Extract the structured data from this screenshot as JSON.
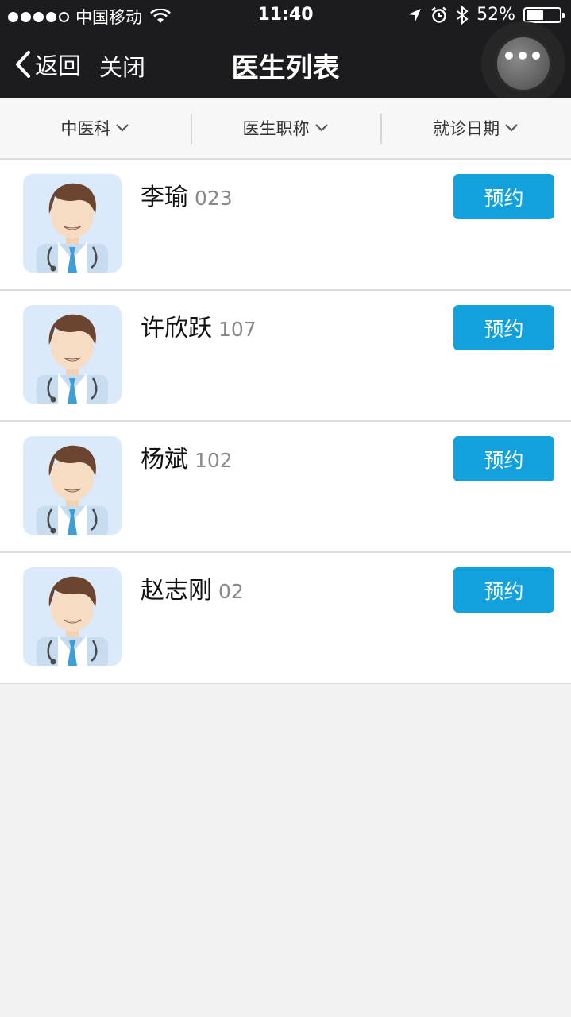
{
  "status_bar": {
    "carrier": "中国移动",
    "time": "11:40",
    "battery_percent": "52%",
    "battery_level": 0.52,
    "icons": [
      "signal-dots-icon",
      "wifi-icon",
      "location-arrow-icon",
      "alarm-clock-icon",
      "bluetooth-icon",
      "battery-icon"
    ]
  },
  "nav": {
    "back_label": "返回",
    "close_label": "关闭",
    "title": "医生列表"
  },
  "filters": [
    {
      "label": "中医科"
    },
    {
      "label": "医生职称"
    },
    {
      "label": "就诊日期"
    }
  ],
  "doctors": [
    {
      "name": "李瑜",
      "id": "023",
      "book_label": "预约"
    },
    {
      "name": "许欣跃",
      "id": "107",
      "book_label": "预约"
    },
    {
      "name": "杨斌",
      "id": "102",
      "book_label": "预约"
    },
    {
      "name": "赵志刚",
      "id": "02",
      "book_label": "预约"
    }
  ],
  "colors": {
    "bar_bg": "#1c1c1e",
    "accent": "#13a1de",
    "page_bg": "#f2f2f2",
    "avatar_bg": "#dbeafa"
  }
}
